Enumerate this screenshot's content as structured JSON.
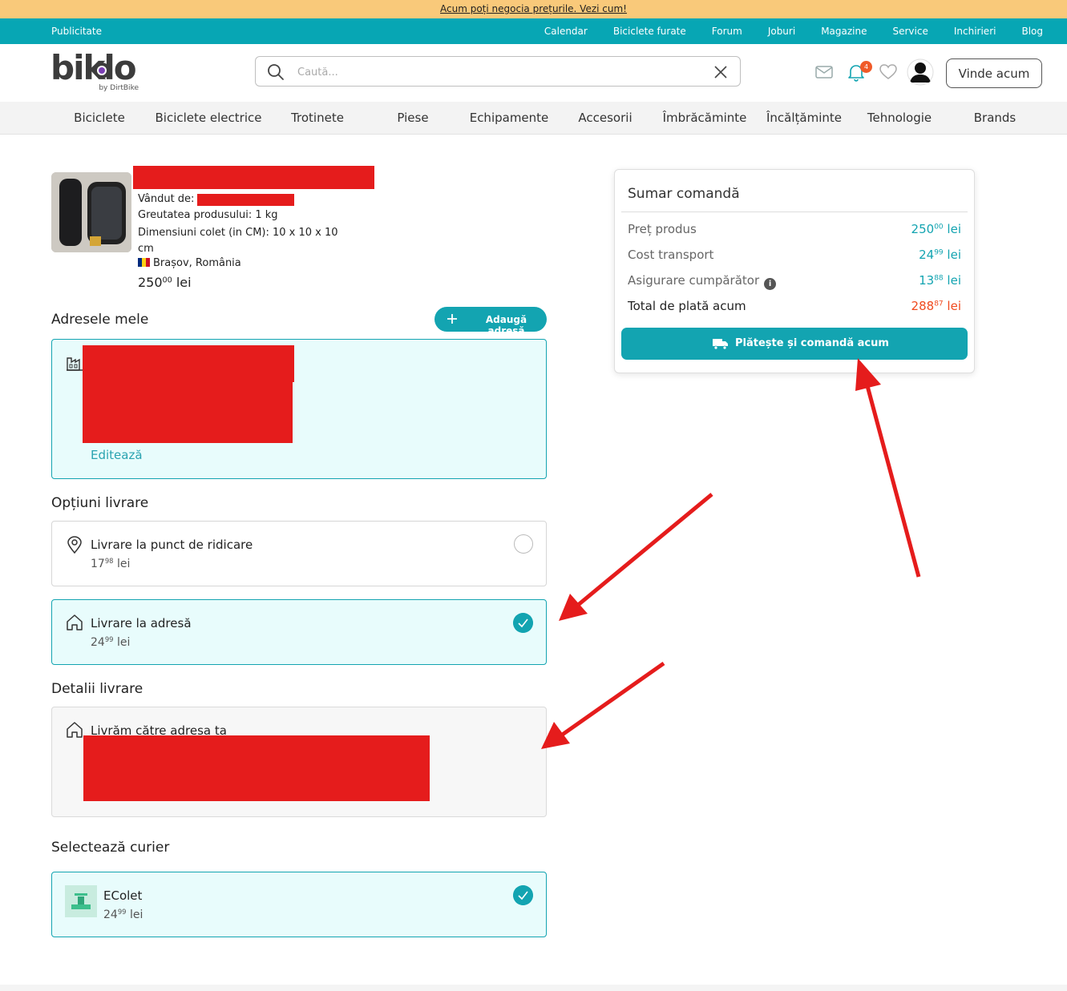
{
  "promo": {
    "text": "Acum poți negocia prețurile. Vezi cum!"
  },
  "top_nav": {
    "left": "Publicitate",
    "items": [
      "Calendar",
      "Biciclete furate",
      "Forum",
      "Joburi",
      "Magazine",
      "Service",
      "Inchirieri",
      "Blog"
    ]
  },
  "header": {
    "logo_text": "biklo",
    "logo_sub": "by DirtBike",
    "search_placeholder": "Caută...",
    "notification_count": "4",
    "sell_button": "Vinde acum"
  },
  "categories": [
    "Biciclete",
    "Biciclete electrice",
    "Trotinete",
    "Piese",
    "Echipamente",
    "Accesorii",
    "Îmbrăcăminte",
    "Încălțăminte",
    "Tehnologie",
    "Brands"
  ],
  "product": {
    "sold_by_label": "Vândut de:",
    "weight": "Greutatea produsului: 1 kg",
    "dimensions": "Dimensiuni colet (in CM): 10 x 10 x 10 cm",
    "location": "Brașov, România",
    "price_int": "250",
    "price_dec": "00",
    "currency": "lei"
  },
  "addresses": {
    "title": "Adresele mele",
    "add_button": "Adaugă adresă",
    "edit_link": "Editează"
  },
  "delivery_options": {
    "title": "Opțiuni livrare",
    "options": [
      {
        "label": "Livrare la punct de ridicare",
        "price_int": "17",
        "price_dec": "98",
        "currency": "lei",
        "selected": false
      },
      {
        "label": "Livrare la adresă",
        "price_int": "24",
        "price_dec": "99",
        "currency": "lei",
        "selected": true
      }
    ]
  },
  "delivery_details": {
    "title": "Detalii livrare",
    "text": "Livrăm către adresa ta"
  },
  "courier": {
    "title": "Selectează curier",
    "name": "EColet",
    "price_int": "24",
    "price_dec": "99",
    "currency": "lei",
    "selected": true
  },
  "summary": {
    "title": "Sumar comandă",
    "rows": [
      {
        "label": "Preț produs",
        "int": "250",
        "dec": "00",
        "currency": "lei"
      },
      {
        "label": "Cost transport",
        "int": "24",
        "dec": "99",
        "currency": "lei"
      },
      {
        "label": "Asigurare cumpărător",
        "int": "13",
        "dec": "88",
        "currency": "lei"
      }
    ],
    "total": {
      "label": "Total de plată acum",
      "int": "288",
      "dec": "87",
      "currency": "lei"
    },
    "pay_button": "Plătește și comandă acum"
  },
  "colors": {
    "accent": "#13a4b1",
    "promo_bg": "#f9c97a",
    "total_red": "#f04a1e",
    "annotation_red": "#e51c1c"
  }
}
